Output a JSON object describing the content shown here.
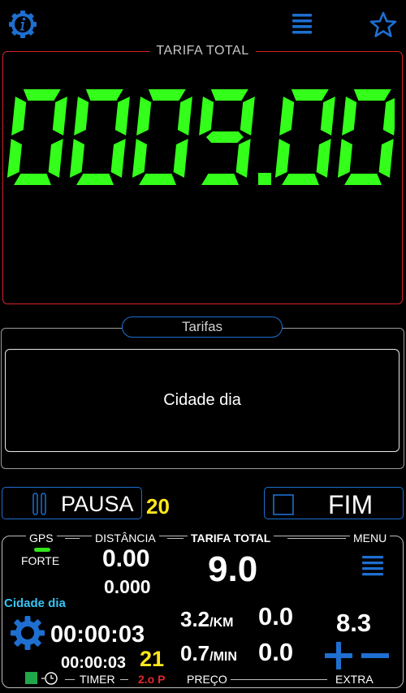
{
  "header": {
    "info_icon": "info-gear-icon",
    "menu_icon": "hamburger-icon",
    "favorite_icon": "star-icon"
  },
  "fare": {
    "title": "TARIFA TOTAL",
    "display": "0009.00"
  },
  "tariffs": {
    "label": "Tarifas",
    "selected": "Cidade dia"
  },
  "controls": {
    "pause_label": "PAUSA",
    "pause_count": "20",
    "end_label": "FIM"
  },
  "panel": {
    "gps_label": "GPS",
    "gps_strength": "FORTE",
    "distance_label": "DISTÂNCIA",
    "distance_value": "0.00",
    "distance_sub": "0.000",
    "total_label": "TARIFA TOTAL",
    "total_value": "9.0",
    "menu_label": "MENU",
    "tariff_name": "Cidade dia",
    "timer_main": "00:00:03",
    "timer_sub": "00:00:03",
    "timer_count": "21",
    "rate_km": "3.2",
    "rate_km_unit": "/KM",
    "rate_km_amount": "0.0",
    "rate_min": "0.7",
    "rate_min_unit": "/MIN",
    "rate_min_amount": "0.0",
    "extra_value": "8.3",
    "timer_label": "TIMER",
    "period_label": "2.o P",
    "price_label": "PREÇO",
    "extra_label": "EXTRA"
  },
  "colors": {
    "accent_blue": "#1e6fd0",
    "digit_green": "#33ff1a",
    "red": "#d2232a",
    "yellow": "#ffe61a",
    "cyan": "#35c5f5"
  }
}
